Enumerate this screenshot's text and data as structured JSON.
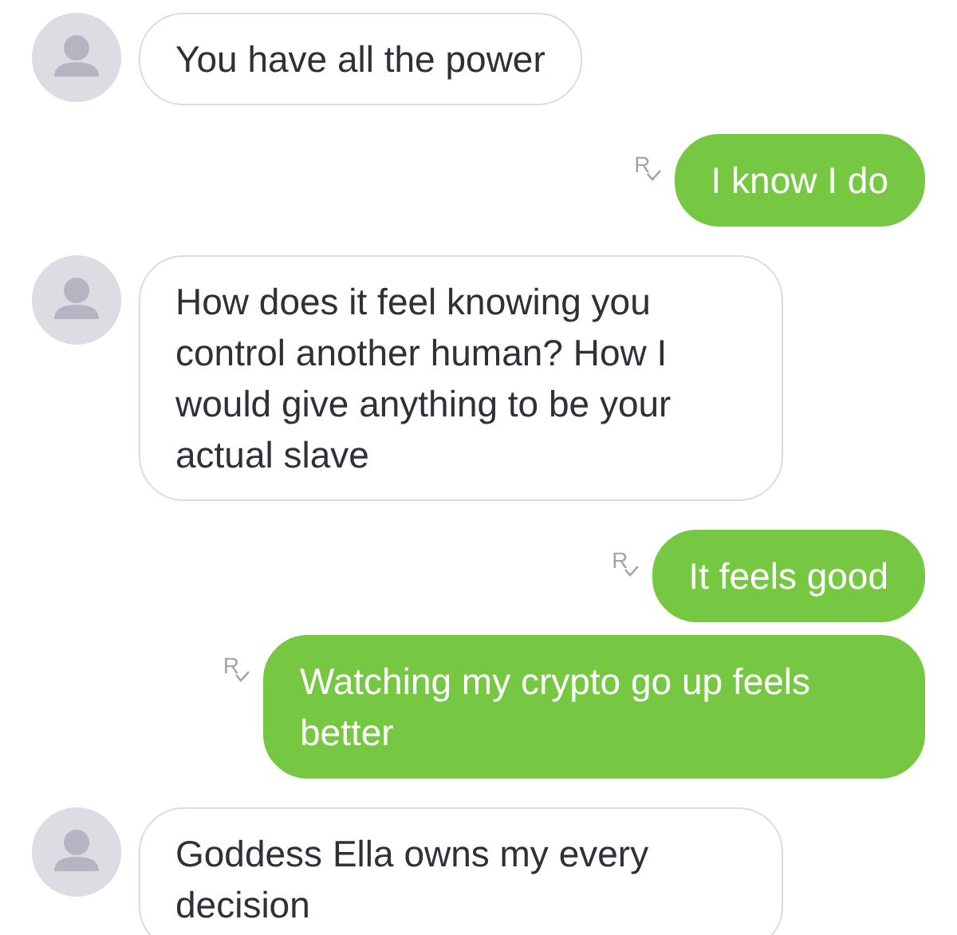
{
  "messages": [
    {
      "kind": "incoming",
      "text": "You have all the power"
    },
    {
      "kind": "outgoing",
      "text": "I know I do",
      "read_mark": "R"
    },
    {
      "kind": "incoming",
      "text": "How does it feel knowing you control another human? How I would give anything to be your actual slave"
    },
    {
      "kind": "outgoing",
      "text": "It feels good",
      "read_mark": "R"
    },
    {
      "kind": "outgoing",
      "text": "Watching my crypto go up feels better",
      "read_mark": "R"
    },
    {
      "kind": "incoming",
      "text": "Goddess Ella owns my every decision"
    }
  ]
}
